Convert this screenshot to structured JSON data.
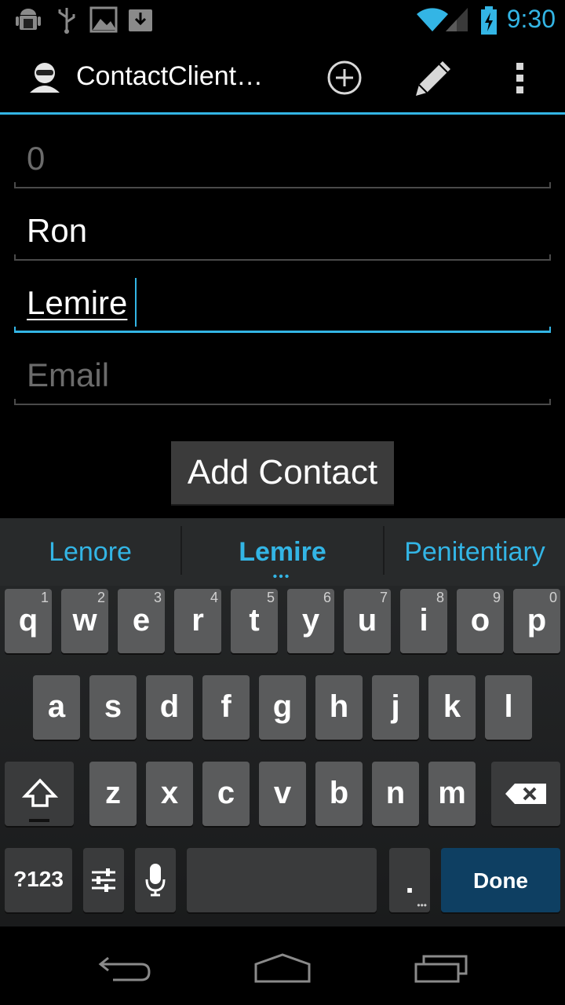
{
  "status_bar": {
    "time": "9:30",
    "icons": [
      "android-debug-icon",
      "usb-icon",
      "image-icon",
      "download-icon",
      "wifi-icon",
      "signal-icon",
      "battery-charging-icon"
    ],
    "accent_color": "#33b5e5"
  },
  "action_bar": {
    "title": "ContactClient…",
    "icons": [
      "app-contact-icon",
      "add-circle-icon",
      "edit-pencil-icon",
      "overflow-menu-icon"
    ]
  },
  "form": {
    "id_field": {
      "placeholder": "0"
    },
    "first_name": {
      "value": "Ron"
    },
    "last_name": {
      "value": "Lemire"
    },
    "email": {
      "placeholder": "Email"
    },
    "add_button_label": "Add Contact"
  },
  "keyboard": {
    "suggestions": [
      "Lenore",
      "Lemire",
      "Penitentiary"
    ],
    "suggestion_more": "•••",
    "row1": [
      {
        "l": "q",
        "n": "1"
      },
      {
        "l": "w",
        "n": "2"
      },
      {
        "l": "e",
        "n": "3"
      },
      {
        "l": "r",
        "n": "4"
      },
      {
        "l": "t",
        "n": "5"
      },
      {
        "l": "y",
        "n": "6"
      },
      {
        "l": "u",
        "n": "7"
      },
      {
        "l": "i",
        "n": "8"
      },
      {
        "l": "o",
        "n": "9"
      },
      {
        "l": "p",
        "n": "0"
      }
    ],
    "row2": [
      "a",
      "s",
      "d",
      "f",
      "g",
      "h",
      "j",
      "k",
      "l"
    ],
    "row3": [
      "z",
      "x",
      "c",
      "v",
      "b",
      "n",
      "m"
    ],
    "symbols_label": "?123",
    "period_label": ".",
    "done_label": "Done",
    "done_color": "#0e3f62"
  },
  "nav_bar": {
    "icons": [
      "back-icon",
      "home-icon",
      "recent-apps-icon"
    ]
  }
}
